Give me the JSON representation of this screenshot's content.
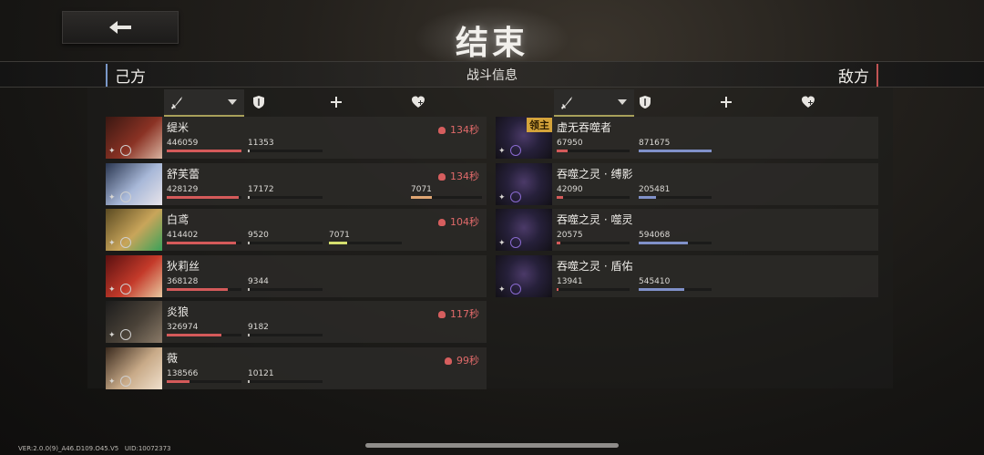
{
  "header": {
    "title": "结束",
    "info_title": "战斗信息",
    "side_left": "己方",
    "side_right": "敌方"
  },
  "colors": {
    "ally_bar": "#d45a5a",
    "enemy_bar": "#8091c9",
    "support_bar": "#e0a673",
    "heal_bar": "#d4df6e",
    "time_text": "#e06a6a"
  },
  "icons": {
    "back": "back-arrow-icon",
    "damage": "sword-icon",
    "defense": "shield-icon",
    "support": "plus-icon",
    "heal": "heart-plus-icon",
    "skull": "skull-icon"
  },
  "allies": [
    {
      "name": "缇米",
      "damage": "446059",
      "damage_ratio": 1.0,
      "taken": "11353",
      "taken_ratio": 0.02,
      "support": "",
      "support_ratio": 0,
      "heal": "",
      "heal_ratio": 0,
      "time": "134秒",
      "portrait": [
        "#3a1812",
        "#8a3224",
        "#d9b3a0"
      ]
    },
    {
      "name": "舒芙蕾",
      "damage": "428129",
      "damage_ratio": 0.96,
      "taken": "17172",
      "taken_ratio": 0.03,
      "support": "",
      "support_ratio": 0,
      "heal": "7071",
      "heal_ratio": 0.3,
      "time": "134秒",
      "portrait": [
        "#2a3650",
        "#a8b8d8",
        "#e8e4ea"
      ]
    },
    {
      "name": "白鸢",
      "damage": "414402",
      "damage_ratio": 0.93,
      "taken": "9520",
      "taken_ratio": 0.02,
      "support": "7071",
      "support_ratio": 0.25,
      "heal": "",
      "heal_ratio": 0,
      "time": "104秒",
      "portrait": [
        "#5a4a22",
        "#c9a55a",
        "#3aa25a"
      ]
    },
    {
      "name": "狄莉丝",
      "damage": "368128",
      "damage_ratio": 0.82,
      "taken": "9344",
      "taken_ratio": 0.02,
      "support": "",
      "support_ratio": 0,
      "heal": "",
      "heal_ratio": 0,
      "time": "",
      "portrait": [
        "#5a1010",
        "#c43a2a",
        "#e8c8a0"
      ]
    },
    {
      "name": "炎狼",
      "damage": "326974",
      "damage_ratio": 0.73,
      "taken": "9182",
      "taken_ratio": 0.02,
      "support": "",
      "support_ratio": 0,
      "heal": "",
      "heal_ratio": 0,
      "time": "117秒",
      "portrait": [
        "#1c1c1c",
        "#4a4238",
        "#8a7a68"
      ]
    },
    {
      "name": "薇",
      "damage": "138566",
      "damage_ratio": 0.31,
      "taken": "10121",
      "taken_ratio": 0.02,
      "support": "",
      "support_ratio": 0,
      "heal": "",
      "heal_ratio": 0,
      "time": "99秒",
      "portrait": [
        "#3a2a1e",
        "#c8aa88",
        "#f0e0cc"
      ]
    }
  ],
  "enemies": [
    {
      "name": "虚无吞噬者",
      "badge": "领主",
      "damage": "67950",
      "damage_ratio": 0.15,
      "taken": "871675",
      "taken_ratio": 1.0
    },
    {
      "name": "吞噬之灵 · 缚影",
      "badge": "",
      "damage": "42090",
      "damage_ratio": 0.09,
      "taken": "205481",
      "taken_ratio": 0.24
    },
    {
      "name": "吞噬之灵 · 噬灵",
      "badge": "",
      "damage": "20575",
      "damage_ratio": 0.05,
      "taken": "594068",
      "taken_ratio": 0.68
    },
    {
      "name": "吞噬之灵 · 盾佑",
      "badge": "",
      "damage": "13941",
      "damage_ratio": 0.03,
      "taken": "545410",
      "taken_ratio": 0.63
    }
  ],
  "footer": {
    "version": "VER:2.0.0(9)_A46.D109.O45.V5",
    "uid": "UID:10072373"
  }
}
